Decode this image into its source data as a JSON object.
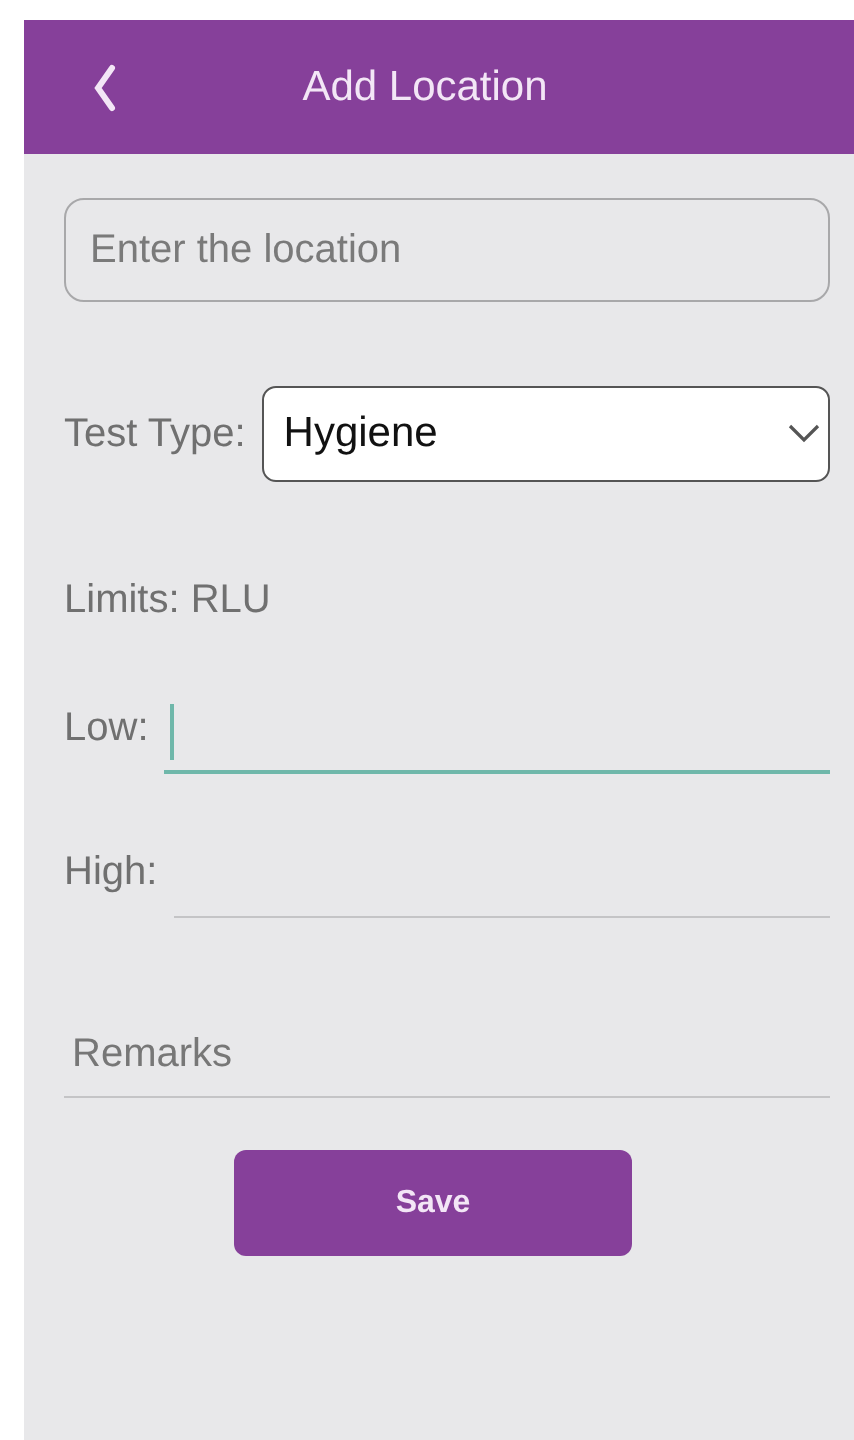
{
  "header": {
    "title": "Add Location"
  },
  "location_field": {
    "placeholder": "Enter the location"
  },
  "test_type": {
    "label": "Test Type:",
    "value": "Hygiene"
  },
  "limits": "Limits: RLU",
  "limit_fields": [
    {
      "label": "Low:",
      "focused": true
    },
    {
      "label": "High:",
      "focused": false
    }
  ],
  "remarks_field": {
    "placeholder": "Remarks"
  },
  "save_button": "Save"
}
